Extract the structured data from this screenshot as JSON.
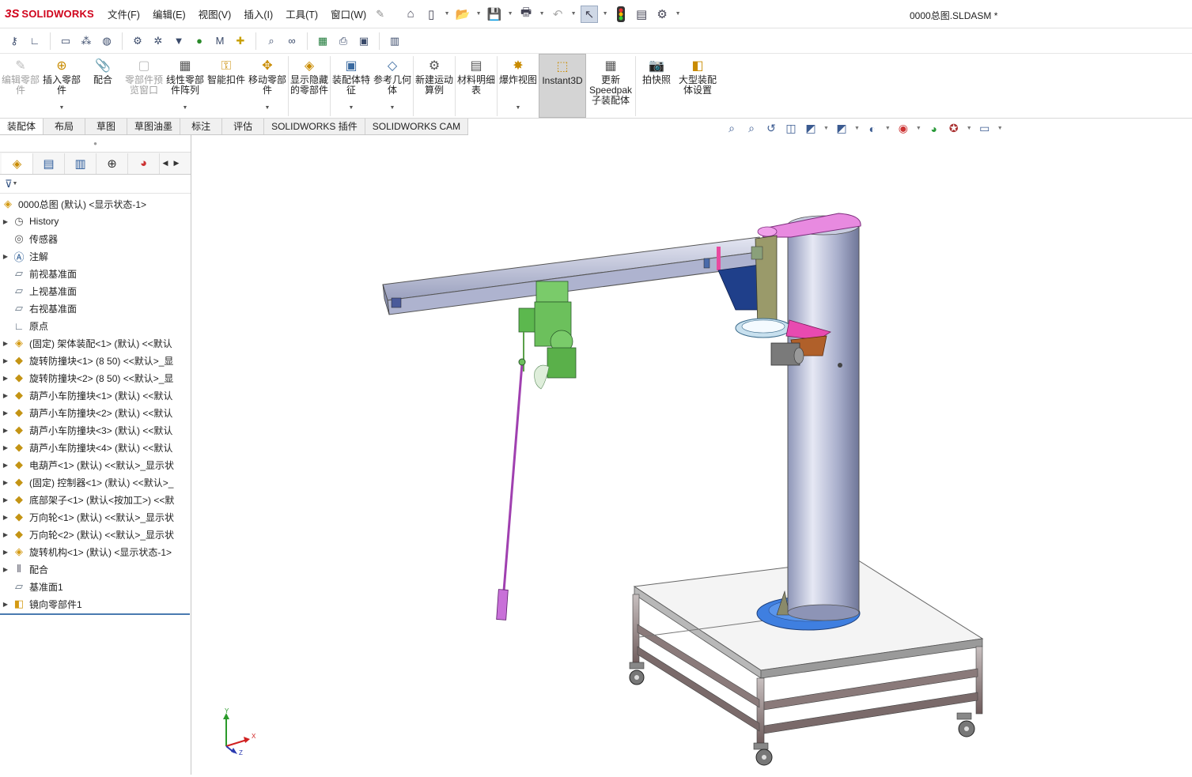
{
  "app": {
    "brand_ds": "3S",
    "brand_name": "SOLIDWORKS"
  },
  "menus": [
    "文件(F)",
    "编辑(E)",
    "视图(V)",
    "插入(I)",
    "工具(T)",
    "窗口(W)"
  ],
  "document_title": "0000总图.SLDASM *",
  "ribbon": {
    "buttons": [
      {
        "label": "编辑零部件",
        "disabled": true
      },
      {
        "label": "插入零部件",
        "disabled": false
      },
      {
        "label": "配合",
        "disabled": false
      },
      {
        "label": "零部件预览窗口",
        "disabled": true
      },
      {
        "label": "线性零部件阵列",
        "disabled": false
      },
      {
        "label": "智能扣件",
        "disabled": false
      },
      {
        "label": "移动零部件",
        "disabled": false
      },
      {
        "label": "显示隐藏的零部件",
        "disabled": false
      },
      {
        "label": "装配体特征",
        "disabled": false
      },
      {
        "label": "参考几何体",
        "disabled": false
      },
      {
        "label": "新建运动算例",
        "disabled": false
      },
      {
        "label": "材料明细表",
        "disabled": false
      },
      {
        "label": "爆炸视图",
        "disabled": false
      },
      {
        "label": "Instant3D",
        "disabled": false
      },
      {
        "label": "更新Speedpak子装配体",
        "disabled": false
      },
      {
        "label": "拍快照",
        "disabled": false
      },
      {
        "label": "大型装配体设置",
        "disabled": false
      }
    ]
  },
  "command_tabs": [
    "装配体",
    "布局",
    "草图",
    "草图油墨",
    "标注",
    "评估",
    "SOLIDWORKS 插件",
    "SOLIDWORKS CAM"
  ],
  "tree": {
    "root": "0000总图 (默认) <显示状态-1>",
    "items": [
      {
        "label": "History",
        "icon": "history-icon",
        "expand": true
      },
      {
        "label": "传感器",
        "icon": "sensor-icon",
        "expand": false
      },
      {
        "label": "注解",
        "icon": "annotation-icon",
        "expand": true
      },
      {
        "label": "前视基准面",
        "icon": "plane-icon",
        "expand": false
      },
      {
        "label": "上视基准面",
        "icon": "plane-icon",
        "expand": false
      },
      {
        "label": "右视基准面",
        "icon": "plane-icon",
        "expand": false
      },
      {
        "label": "原点",
        "icon": "origin-icon",
        "expand": false
      },
      {
        "label": "(固定) 架体装配<1> (默认) <<默认",
        "icon": "subassembly-icon",
        "expand": true
      },
      {
        "label": "旋转防撞块<1> (8 50) <<默认>_显",
        "icon": "part-icon",
        "expand": true
      },
      {
        "label": "旋转防撞块<2> (8 50) <<默认>_显",
        "icon": "part-icon",
        "expand": true
      },
      {
        "label": "葫芦小车防撞块<1> (默认) <<默认",
        "icon": "part-icon",
        "expand": true
      },
      {
        "label": "葫芦小车防撞块<2> (默认) <<默认",
        "icon": "part-icon",
        "expand": true
      },
      {
        "label": "葫芦小车防撞块<3> (默认) <<默认",
        "icon": "part-icon",
        "expand": true
      },
      {
        "label": "葫芦小车防撞块<4> (默认) <<默认",
        "icon": "part-icon",
        "expand": true
      },
      {
        "label": "电葫芦<1> (默认) <<默认>_显示状",
        "icon": "part-icon",
        "expand": true
      },
      {
        "label": "(固定) 控制器<1> (默认) <<默认>_",
        "icon": "part-icon",
        "expand": true
      },
      {
        "label": "底部架子<1> (默认<按加工>) <<默",
        "icon": "part-icon",
        "expand": true
      },
      {
        "label": "万向轮<1> (默认) <<默认>_显示状",
        "icon": "part-icon",
        "expand": true
      },
      {
        "label": "万向轮<2> (默认) <<默认>_显示状",
        "icon": "part-icon",
        "expand": true
      },
      {
        "label": "旋转机构<1> (默认) <显示状态-1>",
        "icon": "subassembly-icon",
        "expand": true
      },
      {
        "label": "配合",
        "icon": "mates-icon",
        "expand": true
      },
      {
        "label": "基准面1",
        "icon": "plane-icon",
        "expand": false
      },
      {
        "label": "镜向零部件1",
        "icon": "mirror-icon",
        "expand": true
      }
    ]
  },
  "triad": {
    "x": "X",
    "y": "Y",
    "z": "Z"
  },
  "colors": {
    "accent_red": "#d0021b",
    "tree_selection_line": "#4a7ab0"
  }
}
